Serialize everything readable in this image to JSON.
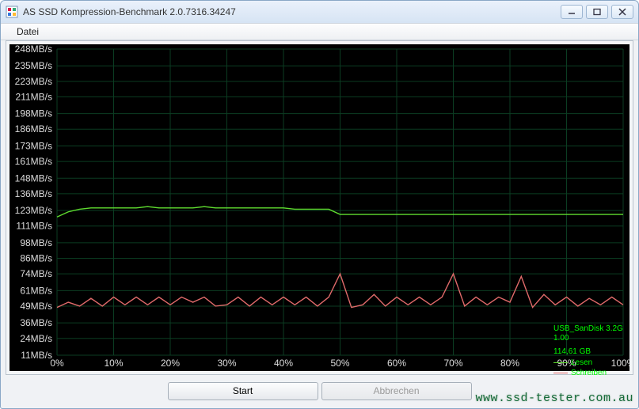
{
  "window": {
    "title": "AS SSD Kompression-Benchmark 2.0.7316.34247"
  },
  "menu": {
    "datei": "Datei"
  },
  "buttons": {
    "start": "Start",
    "abbrechen": "Abbrechen"
  },
  "watermark": "www.ssd-tester.com.au",
  "legend": {
    "device": "USB_SanDisk 3.2G",
    "firmware": "1.00",
    "capacity": "114,61 GB",
    "read_label": "Lesen",
    "write_label": "Schreiben"
  },
  "chart_data": {
    "type": "line",
    "xlabel": "",
    "ylabel": "",
    "x_unit": "%",
    "y_unit": "MB/s",
    "xlim": [
      0,
      100
    ],
    "ylim": [
      11,
      248
    ],
    "x_ticks": [
      0,
      10,
      20,
      30,
      40,
      50,
      60,
      70,
      80,
      90,
      100
    ],
    "x_tick_labels": [
      "0%",
      "10%",
      "20%",
      "30%",
      "40%",
      "50%",
      "60%",
      "70%",
      "80%",
      "90%",
      "100%"
    ],
    "y_ticks": [
      11,
      24,
      36,
      49,
      61,
      74,
      86,
      98,
      111,
      123,
      136,
      148,
      161,
      173,
      186,
      198,
      211,
      223,
      235,
      248
    ],
    "y_tick_labels": [
      "11MB/s",
      "24MB/s",
      "36MB/s",
      "49MB/s",
      "61MB/s",
      "74MB/s",
      "86MB/s",
      "98MB/s",
      "111MB/s",
      "123MB/s",
      "136MB/s",
      "148MB/s",
      "161MB/s",
      "173MB/s",
      "186MB/s",
      "198MB/s",
      "211MB/s",
      "223MB/s",
      "235MB/s",
      "248MB/s"
    ],
    "series": [
      {
        "name": "Lesen",
        "color": "#5fdc2f",
        "x": [
          0,
          2,
          4,
          6,
          8,
          10,
          12,
          14,
          16,
          18,
          20,
          22,
          24,
          26,
          28,
          30,
          32,
          34,
          36,
          38,
          40,
          42,
          44,
          46,
          48,
          50,
          52,
          54,
          56,
          58,
          60,
          62,
          64,
          66,
          68,
          70,
          72,
          74,
          76,
          78,
          80,
          82,
          84,
          86,
          88,
          90,
          92,
          94,
          96,
          98,
          100
        ],
        "y": [
          118,
          122,
          124,
          125,
          125,
          125,
          125,
          125,
          126,
          125,
          125,
          125,
          125,
          126,
          125,
          125,
          125,
          125,
          125,
          125,
          125,
          124,
          124,
          124,
          124,
          120,
          120,
          120,
          120,
          120,
          120,
          120,
          120,
          120,
          120,
          120,
          120,
          120,
          120,
          120,
          120,
          120,
          120,
          120,
          120,
          120,
          120,
          120,
          120,
          120,
          120
        ]
      },
      {
        "name": "Schreiben",
        "color": "#e06a6a",
        "x": [
          0,
          2,
          4,
          6,
          8,
          10,
          12,
          14,
          16,
          18,
          20,
          22,
          24,
          26,
          28,
          30,
          32,
          34,
          36,
          38,
          40,
          42,
          44,
          46,
          48,
          50,
          52,
          54,
          56,
          58,
          60,
          62,
          64,
          66,
          68,
          70,
          72,
          74,
          76,
          78,
          80,
          82,
          84,
          86,
          88,
          90,
          92,
          94,
          96,
          98,
          100
        ],
        "y": [
          48,
          52,
          49,
          55,
          49,
          56,
          50,
          56,
          50,
          56,
          50,
          56,
          52,
          56,
          49,
          50,
          56,
          49,
          56,
          50,
          56,
          50,
          56,
          49,
          56,
          74,
          48,
          50,
          58,
          49,
          56,
          50,
          56,
          50,
          56,
          74,
          49,
          56,
          50,
          56,
          52,
          72,
          48,
          58,
          50,
          56,
          49,
          55,
          50,
          56,
          50
        ]
      }
    ]
  }
}
